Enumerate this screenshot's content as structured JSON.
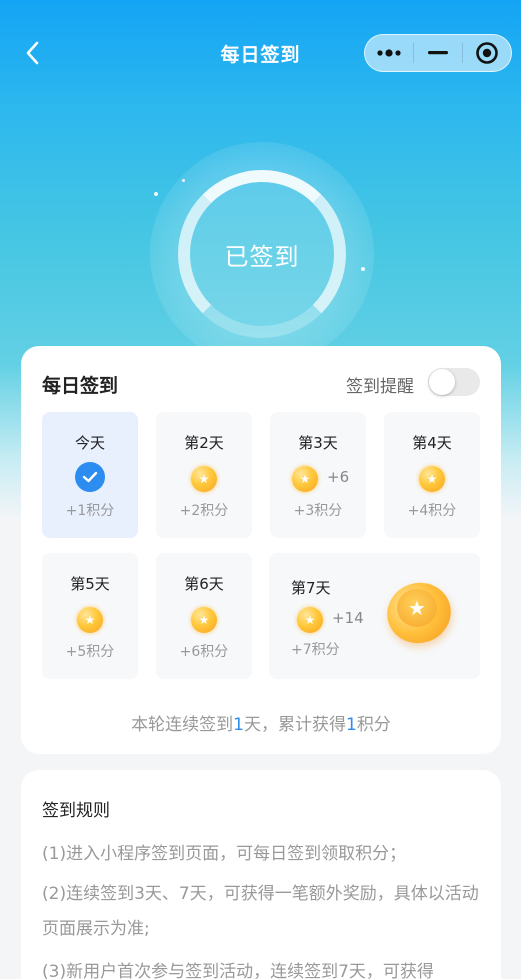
{
  "nav": {
    "title": "每日签到",
    "back_icon": "chevron-left-icon",
    "capsule": {
      "more_icon": "more-dots-icon",
      "minimize_icon": "minimize-icon",
      "close_icon": "target-close-icon"
    }
  },
  "status": {
    "text": "已签到"
  },
  "checkin": {
    "title": "每日签到",
    "reminder_label": "签到提醒",
    "reminder_on": false,
    "days": [
      {
        "label": "今天",
        "points": "+1积分",
        "state": "checked"
      },
      {
        "label": "第2天",
        "points": "+2积分"
      },
      {
        "label": "第3天",
        "points": "+3积分",
        "bonus": "+6"
      },
      {
        "label": "第4天",
        "points": "+4积分"
      },
      {
        "label": "第5天",
        "points": "+5积分"
      },
      {
        "label": "第6天",
        "points": "+6积分"
      },
      {
        "label": "第7天",
        "points": "+7积分",
        "bonus": "+14"
      }
    ],
    "summary": {
      "prefix": "本轮连续签到",
      "days": "1",
      "middle": "天，累计获得",
      "points": "1",
      "suffix": "积分"
    },
    "colors": {
      "accent": "#2d8cf0",
      "coin": "#ffc83a"
    }
  },
  "rules": {
    "title": "签到规则",
    "items": [
      "(1)进入小程序签到页面，可每日签到领取积分；",
      "(2)连续签到3天、7天，可获得一笔额外奖励，具体以活动页面展示为准;",
      "(3)新用户首次参与签到活动，连续签到7天，可获得"
    ]
  }
}
